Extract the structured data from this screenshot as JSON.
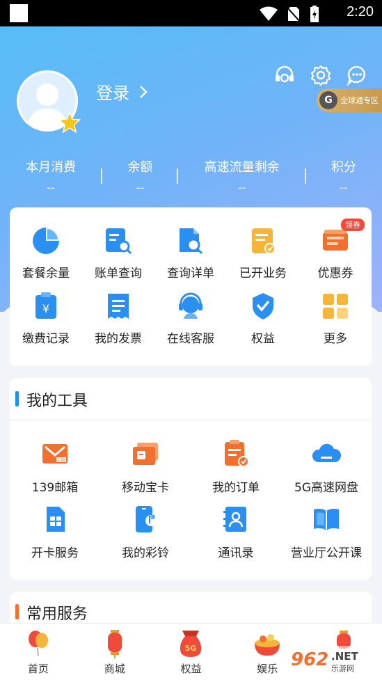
{
  "status_bar": {
    "time": "2:20"
  },
  "header": {
    "login_label": "登录",
    "global_badge": "全球通专区",
    "stats": [
      {
        "label": "本月消费",
        "value": "--"
      },
      {
        "label": "余额",
        "value": "--"
      },
      {
        "label": "高速流量剩余",
        "value": "--"
      },
      {
        "label": "积分",
        "value": "--"
      }
    ]
  },
  "quick_menu": {
    "coupon_tag": "领券",
    "items": [
      {
        "label": "套餐余量",
        "icon": "pie-chart-icon"
      },
      {
        "label": "账单查询",
        "icon": "bill-search-icon"
      },
      {
        "label": "查询详单",
        "icon": "detail-search-icon"
      },
      {
        "label": "已开业务",
        "icon": "opened-service-icon"
      },
      {
        "label": "优惠券",
        "icon": "coupon-icon"
      },
      {
        "label": "缴费记录",
        "icon": "payment-record-icon"
      },
      {
        "label": "我的发票",
        "icon": "invoice-icon"
      },
      {
        "label": "在线客服",
        "icon": "customer-service-icon"
      },
      {
        "label": "权益",
        "icon": "rights-icon"
      },
      {
        "label": "更多",
        "icon": "more-grid-icon"
      }
    ]
  },
  "tools": {
    "title": "我的工具",
    "items": [
      {
        "label": "139邮箱",
        "icon": "mail-139-icon"
      },
      {
        "label": "移动宝卡",
        "icon": "sim-card-icon"
      },
      {
        "label": "我的订单",
        "icon": "order-icon"
      },
      {
        "label": "5G高速网盘",
        "icon": "cloud-disk-icon"
      },
      {
        "label": "开卡服务",
        "icon": "open-card-icon"
      },
      {
        "label": "我的彩铃",
        "icon": "ringtone-icon"
      },
      {
        "label": "通讯录",
        "icon": "contacts-icon"
      },
      {
        "label": "营业厅公开课",
        "icon": "open-class-icon"
      }
    ]
  },
  "services": {
    "title": "常用服务"
  },
  "tabbar": {
    "items": [
      {
        "label": "首页",
        "icon": "home-balloon-icon"
      },
      {
        "label": "商城",
        "icon": "mall-lantern-icon"
      },
      {
        "label": "权益",
        "icon": "rights-bag-icon"
      },
      {
        "label": "娱乐",
        "icon": "entertainment-icon"
      },
      {
        "label": "",
        "icon": "lantern-icon"
      }
    ]
  },
  "colors": {
    "accent": "#1e90e8",
    "orange": "#f07030",
    "gold": "#f5b53a"
  }
}
